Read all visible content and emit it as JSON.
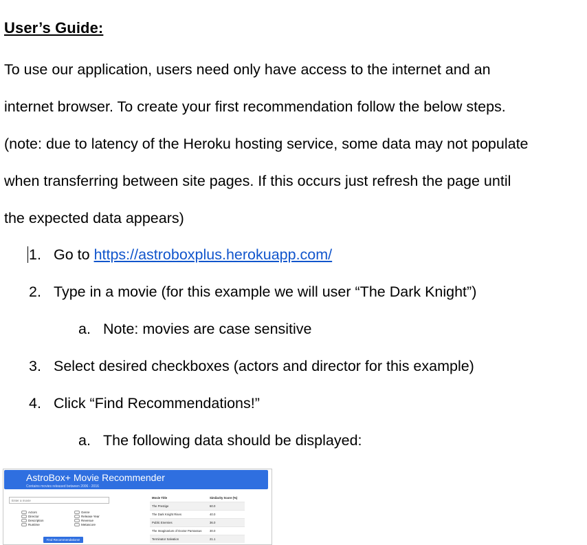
{
  "heading": "User’s Guide:",
  "intro_lines": [
    "To use our application, users need only have access to the internet and an",
    "internet browser. To create your first recommendation follow the below steps.",
    "(note: due to latency of the Heroku hosting service, some data may not populate",
    "when transferring between site pages. If this occurs just refresh the page until",
    "the expected data appears)"
  ],
  "steps": [
    {
      "num": "1.",
      "text": "Go to ",
      "link": "https://astroboxplus.herokuapp.com/"
    },
    {
      "num": "2.",
      "text": "Type in a movie (for this example we will user “The Dark Knight”)"
    },
    {
      "num": "a.",
      "text": "Note: movies are case sensitive"
    },
    {
      "num": "3.",
      "text": "Select desired checkboxes (actors and director for this example)"
    },
    {
      "num": "4.",
      "text": "Click “Find Recommendations!”"
    },
    {
      "num": "a.",
      "text": "The following data should be displayed:"
    }
  ],
  "app_screenshot": {
    "title": "AstroBox+ Movie Recommender",
    "subtitle": "Contains movies released between 2006 - 2016",
    "input_placeholder": "Enter a movie",
    "checkboxes_left": [
      "Actors",
      "Director",
      "Description",
      "Runtime"
    ],
    "checkboxes_right": [
      "Genre",
      "Release Year",
      "Revenue",
      "Metascore"
    ],
    "button_label": "Find Recommendations!",
    "table_headers": [
      "Movie Title",
      "Similarity Score (%)"
    ],
    "table_rows": [
      [
        "The Prestige",
        "60.0"
      ],
      [
        "The Dark Knight Rises",
        "40.0"
      ],
      [
        "Public Enemies",
        "36.0"
      ],
      [
        "The Imaginarium of Doctor Parnassus",
        "30.0"
      ],
      [
        "Terminator Salvation",
        "21.1"
      ]
    ],
    "colors": {
      "banner": "#2f6fe0",
      "link": "#1155cc"
    }
  }
}
